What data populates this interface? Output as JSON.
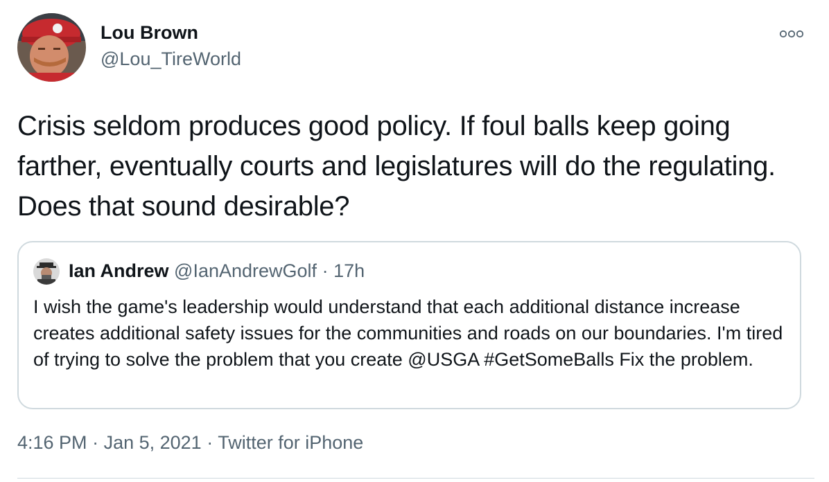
{
  "author": {
    "display_name": "Lou Brown",
    "handle": "@Lou_TireWorld"
  },
  "menu": {
    "icon": "more-dots-icon"
  },
  "tweet": {
    "text": "Crisis seldom produces good policy. If foul balls keep going farther, eventually courts and legislatures will do the regulating. Does that sound desirable?"
  },
  "quote": {
    "display_name": "Ian Andrew",
    "handle": "@IanAndrewGolf",
    "separator": " · ",
    "time_ago": "17h",
    "text": "I wish the game's leadership would understand that each additional distance increase creates additional safety issues for the communities and roads on our boundaries. I'm tired of trying to solve the problem that you create @USGA #GetSomeBalls Fix the problem."
  },
  "footer": {
    "time": "4:16 PM",
    "separator": " · ",
    "date": "Jan 5, 2021",
    "source": "Twitter for iPhone"
  },
  "colors": {
    "text_primary": "#0f1419",
    "text_secondary": "#536471",
    "border": "#cfd9de"
  }
}
